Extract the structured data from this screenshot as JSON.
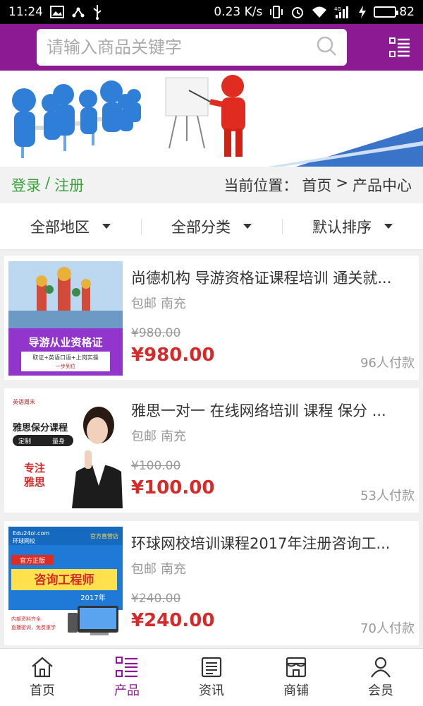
{
  "status_bar": {
    "time": "11:24",
    "network_speed": "0.23 K/s",
    "signal_label": "4G",
    "battery": "82",
    "battery_level": 0.82
  },
  "header": {
    "search_placeholder": "请输入商品关键字",
    "bg_color": "#8c1a92"
  },
  "info_bar": {
    "login": "登录",
    "separator": "/",
    "register": "注册",
    "location_label": "当前位置：",
    "crumb_home": "首页",
    "crumb_sep": ">",
    "crumb_current": "产品中心"
  },
  "filters": [
    {
      "label": "全部地区"
    },
    {
      "label": "全部分类"
    },
    {
      "label": "默认排序"
    }
  ],
  "products": [
    {
      "title": "尚德机构 导游资格证课程培训 通关就...",
      "shipping": "包邮",
      "city": "南充",
      "old_price": "¥980.00",
      "price": "¥980.00",
      "sold": "96人付款",
      "image_text": [
        "导游从业资格证",
        "取证+英语口语+上岗实操",
        "一步到位"
      ]
    },
    {
      "title": "雅思一对一 在线网络培训 课程 保分 ...",
      "shipping": "包邮",
      "city": "南充",
      "old_price": "¥100.00",
      "price": "¥100.00",
      "sold": "53人付款",
      "image_text": [
        "英语周末",
        "雅思保分课程",
        "定制",
        "量身",
        "专注",
        "雅思"
      ]
    },
    {
      "title": "环球网校培训课程2017年注册咨询工...",
      "shipping": "包邮",
      "city": "南充",
      "old_price": "¥240.00",
      "price": "¥240.00",
      "sold": "70人付款",
      "image_text": [
        "Edu24ol.com",
        "环球网校",
        "官方直营店",
        "官方正版",
        "咨询工程师",
        "2017年",
        "内部资料齐全",
        "直播密训，免费重学"
      ]
    }
  ],
  "bottom_nav": [
    {
      "label": "首页",
      "icon": "home-icon"
    },
    {
      "label": "产品",
      "icon": "product-list-icon",
      "active": true
    },
    {
      "label": "资讯",
      "icon": "news-icon"
    },
    {
      "label": "商铺",
      "icon": "shop-icon"
    },
    {
      "label": "会员",
      "icon": "user-icon"
    }
  ]
}
